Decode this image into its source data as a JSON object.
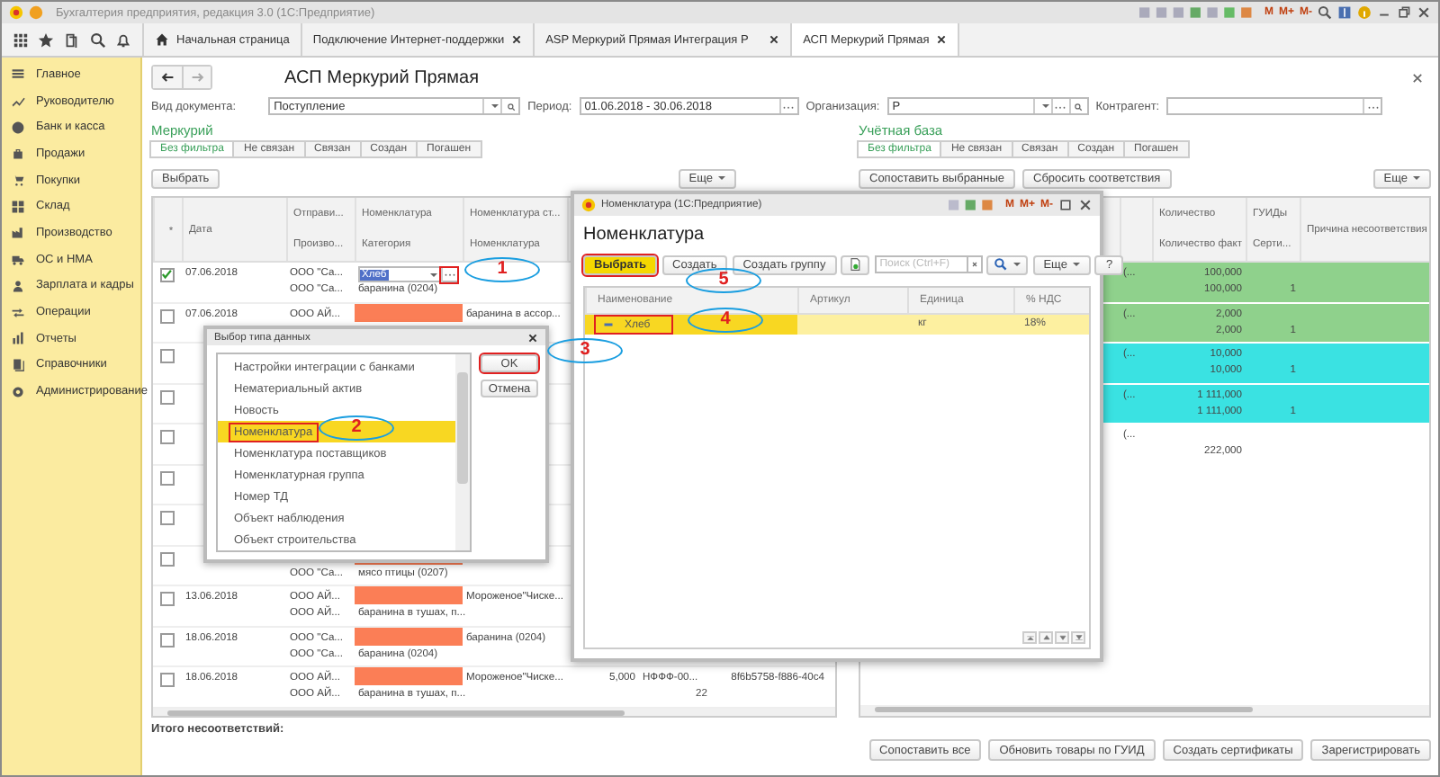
{
  "window": {
    "title": "Бухгалтерия предприятия, редакция 3.0 (1С:Предприятие)",
    "memory_buttons": [
      "M",
      "M+",
      "M-"
    ]
  },
  "tabs": [
    {
      "label": "Начальная страница",
      "kind": "home",
      "selected": false
    },
    {
      "label": "Подключение Интернет-поддержки",
      "kind": "page",
      "selected": false
    },
    {
      "label": "ASP Меркурий Прямая Интеграция Р",
      "kind": "page",
      "selected": false
    },
    {
      "label": "АСП Меркурий Прямая",
      "kind": "page",
      "selected": true
    }
  ],
  "sidebar": {
    "items": [
      "Главное",
      "Руководителю",
      "Банк и касса",
      "Продажи",
      "Покупки",
      "Склад",
      "Производство",
      "ОС и НМА",
      "Зарплата и кадры",
      "Операции",
      "Отчеты",
      "Справочники",
      "Администрирование"
    ]
  },
  "form": {
    "title": "АСП Меркурий Прямая",
    "fields": [
      {
        "label": "Вид документа:",
        "value": "Поступление",
        "kind": "select"
      },
      {
        "label": "Период:",
        "value": "01.06.2018 - 30.06.2018",
        "kind": "period"
      },
      {
        "label": "Организация:",
        "value": "Р",
        "kind": "ref"
      },
      {
        "label": "Контрагент:",
        "kind": "choice"
      }
    ]
  },
  "mercury": {
    "title": "Меркурий",
    "filters": [
      {
        "label": "Без фильтра",
        "selected": true
      },
      {
        "label": "Не связан",
        "selected": false
      },
      {
        "label": "Связан",
        "selected": false
      },
      {
        "label": "Создан",
        "selected": false
      },
      {
        "label": "Погашен",
        "selected": false
      }
    ],
    "select_button": "Выбрать",
    "more_button": "Еще",
    "columns": [
      {
        "line1": "*"
      },
      {
        "line1": "Дата"
      },
      {
        "line1": "Отправи...",
        "line2": "Произво..."
      },
      {
        "line1": "Номенклатура",
        "line2": "Категория"
      },
      {
        "line1": "Номенклатура ст...",
        "line2": "Номенклатура"
      }
    ],
    "rows": [
      {
        "checked": true,
        "date": "07.06.2018",
        "sender": "ООО \"Са...",
        "producer": "ООО \"Са...",
        "input": "Хлеб",
        "input_button_highlighted": true,
        "category": "баранина (0204)",
        "flag": false
      },
      {
        "checked": false,
        "date": "07.06.2018",
        "sender": "ООО АЙ...",
        "flag": true,
        "nomenclature_st": "баранина в ассор..."
      },
      {
        "checked": false,
        "flag": false
      },
      {
        "checked": false,
        "flag": false
      },
      {
        "checked": false,
        "flag": false
      },
      {
        "checked": false,
        "flag": false
      },
      {
        "checked": false,
        "flag": false
      },
      {
        "checked": false,
        "flag": true,
        "producer": "ООО \"Са...",
        "category": "мясо птицы (0207)"
      },
      {
        "checked": false,
        "date": "13.06.2018",
        "sender": "ООО АЙ...",
        "flag": true,
        "nomenclature_st": "Мороженое\"Чиске...",
        "producer": "ООО АЙ...",
        "category": "баранина в тушах, п..."
      },
      {
        "checked": false,
        "date": "18.06.2018",
        "sender": "ООО \"Са...",
        "flag": true,
        "nomenclature_st": "баранина (0204)",
        "producer": "ООО \"Са...",
        "category": "баранина (0204)"
      },
      {
        "checked": false,
        "date": "18.06.2018",
        "sender": "ООО АЙ...",
        "flag": true,
        "nomenclature_st": "Мороженое\"Чиске...",
        "quantity": "5,000",
        "code": "НФФФ-00...",
        "guid": "8f6b5758-f886-40c4",
        "producer": "ООО АЙ...",
        "category": "баранина в тушах, п...",
        "code_2": "22"
      }
    ]
  },
  "accounting": {
    "title": "Учётная база",
    "filters": [
      {
        "label": "Без фильтра",
        "selected": true
      },
      {
        "label": "Не связан",
        "selected": false
      },
      {
        "label": "Связан",
        "selected": false
      },
      {
        "label": "Создан",
        "selected": false
      },
      {
        "label": "Погашен",
        "selected": false
      }
    ],
    "buttons": [
      "Сопоставить выбранные",
      "Сбросить соответствия"
    ],
    "more_button": "Еще",
    "columns": [
      {
        "line1": "Количество",
        "line2": "Количество факт"
      },
      {
        "line1": "ГУИДы",
        "line2": "Серти..."
      },
      {
        "line1": "Причина несоответствия"
      }
    ],
    "rows": [
      {
        "color": "#8fd18c",
        "column_1": "(...",
        "quantity": "100,000",
        "quantity_fact": "100,000",
        "guids": "1"
      },
      {
        "color": "#8fd18c",
        "column_1": "(...",
        "quantity": "2,000",
        "quantity_fact": "2,000",
        "guids": "1"
      },
      {
        "color": "#3ae2e2",
        "column_1": "(...",
        "quantity": "10,000",
        "quantity_fact": "10,000",
        "guids": "1"
      },
      {
        "color": "#3ae2e2",
        "column_1": "(...",
        "quantity": "1 111,000",
        "quantity_fact": "1 111,000",
        "guids": "1"
      },
      {
        "column_1": "(...",
        "quantity_fact": "222,000"
      }
    ]
  },
  "footer": {
    "total_label": "Итого несоответствий:",
    "buttons": [
      "Сопоставить все",
      "Обновить товары по ГУИД",
      "Создать сертификаты",
      "Зарегистрировать"
    ]
  },
  "type_dialog": {
    "title": "Выбор типа данных",
    "items": [
      {
        "label": "Настройки интеграции с банками",
        "selected": false
      },
      {
        "label": "Нематериальный актив",
        "selected": false
      },
      {
        "label": "Новость",
        "selected": false
      },
      {
        "label": "Номенклатура",
        "selected": true
      },
      {
        "label": "Номенклатура поставщиков",
        "selected": false
      },
      {
        "label": "Номенклатурная группа",
        "selected": false
      },
      {
        "label": "Номер ТД",
        "selected": false
      },
      {
        "label": "Объект наблюдения",
        "selected": false
      },
      {
        "label": "Объект строительства",
        "selected": false
      }
    ],
    "buttons": [
      {
        "label": "OK",
        "highlighted": true
      },
      {
        "label": "Отмена",
        "highlighted": false
      }
    ]
  },
  "nomenclature_dialog": {
    "window_title": "Номенклатура (1С:Предприятие)",
    "memory_buttons": [
      "M",
      "M+",
      "M-"
    ],
    "title": "Номенклатура",
    "select_button": {
      "label": "Выбрать",
      "highlighted": true
    },
    "create_button": "Создать",
    "create_group_button": "Создать группу",
    "search": {
      "placeholder": "Поиск (Ctrl+F)"
    },
    "more_button": "Еще",
    "help_button": "?",
    "columns": [
      "Наименование",
      "Артикул",
      "Единица",
      "% НДС"
    ],
    "rows": [
      {
        "name": "Хлеб",
        "unit": "кг",
        "vat": "18%",
        "selected": true,
        "highlighted": true
      }
    ]
  },
  "annotations": [
    {
      "label": "1"
    },
    {
      "label": "2"
    },
    {
      "label": "3"
    },
    {
      "label": "4"
    },
    {
      "label": "5"
    }
  ]
}
